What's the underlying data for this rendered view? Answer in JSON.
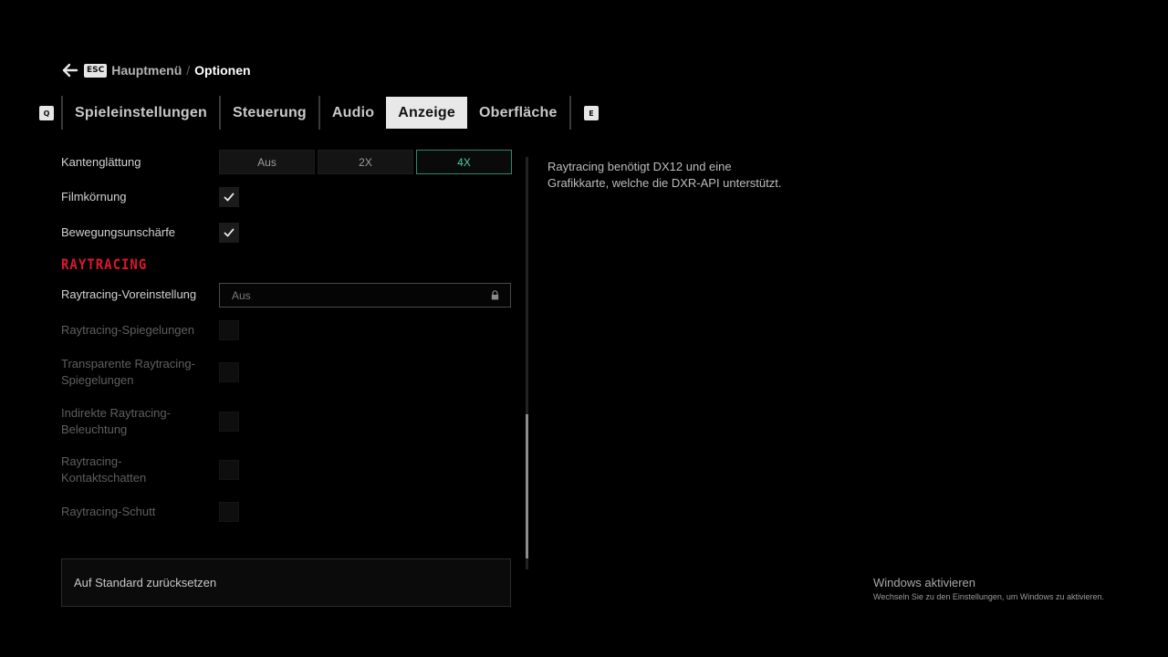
{
  "breadcrumb": {
    "back_icon": "arrow-left-icon",
    "esc_key": "ESC",
    "parent": "Hauptmenü",
    "separator": "/",
    "current": "Optionen"
  },
  "tabs": {
    "prev_key": "Q",
    "next_key": "E",
    "items": [
      {
        "label": "Spieleinstellungen",
        "active": false
      },
      {
        "label": "Steuerung",
        "active": false
      },
      {
        "label": "Audio",
        "active": false
      },
      {
        "label": "Anzeige",
        "active": true
      },
      {
        "label": "Oberfläche",
        "active": false
      }
    ]
  },
  "settings": {
    "antialiasing": {
      "label": "Kantenglättung",
      "options": [
        "Aus",
        "2X",
        "4X"
      ],
      "selected": "4X"
    },
    "film_grain": {
      "label": "Filmkörnung",
      "checked": true
    },
    "motion_blur": {
      "label": "Bewegungsunschärfe",
      "checked": true
    },
    "raytracing_section": "RAYTRACING",
    "rt_preset": {
      "label": "Raytracing-Voreinstellung",
      "value": "Aus",
      "locked": true,
      "lock_icon": "lock-icon"
    },
    "rt_reflections": {
      "label": "Raytracing-Spiegelungen",
      "checked": false,
      "disabled": true
    },
    "rt_transparent": {
      "label_line1": "Transparente Raytracing-",
      "label_line2": "Spiegelungen",
      "checked": false,
      "disabled": true
    },
    "rt_indirect": {
      "label_line1": "Indirekte Raytracing-",
      "label_line2": "Beleuchtung",
      "checked": false,
      "disabled": true
    },
    "rt_contact": {
      "label_line1": "Raytracing-",
      "label_line2": "Kontaktschatten",
      "checked": false,
      "disabled": true
    },
    "rt_debris": {
      "label": "Raytracing-Schutt",
      "checked": false,
      "disabled": true
    }
  },
  "reset_button": "Auf Standard zurücksetzen",
  "description": {
    "line1": "Raytracing benötigt DX12 und eine",
    "line2": "Grafikkarte, welche die DXR-API unterstützt."
  },
  "windows_watermark": {
    "title": "Windows aktivieren",
    "subtitle": "Wechseln Sie zu den Einstellungen, um Windows zu aktivieren."
  },
  "colors": {
    "accent_green": "#3dd3a1",
    "section_red": "#d9182b",
    "tab_active_bg": "#e8e8e8",
    "background": "#000000"
  }
}
